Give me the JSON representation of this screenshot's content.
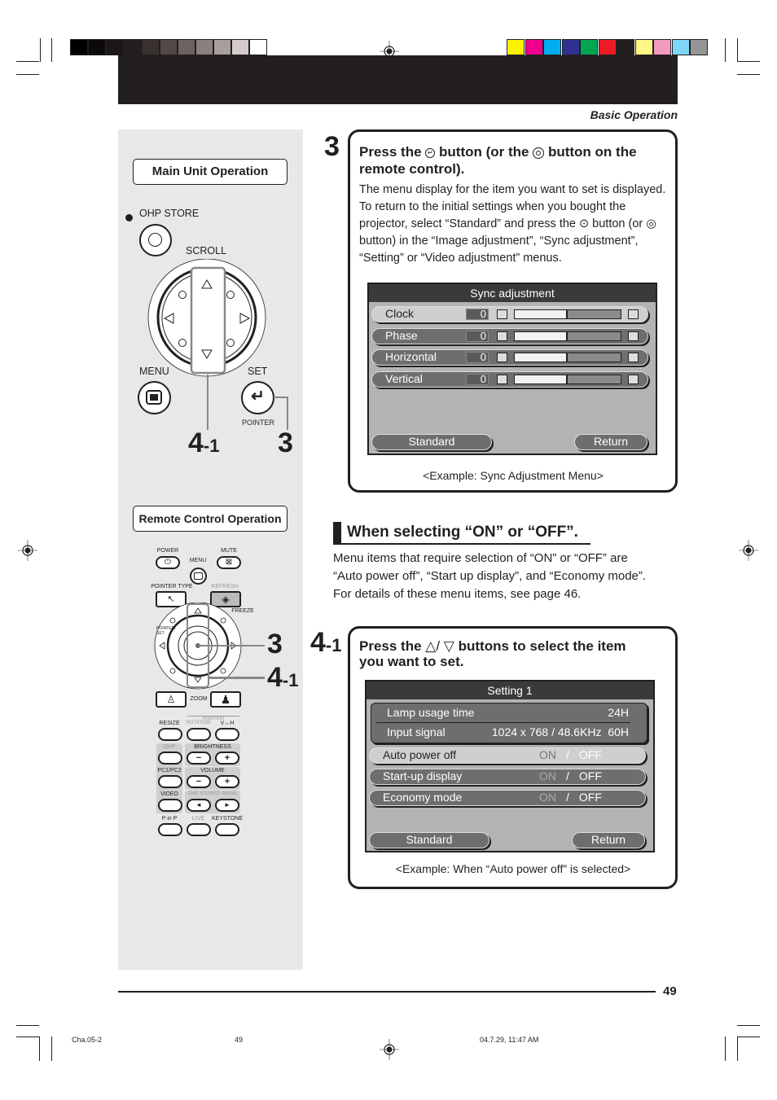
{
  "print_marks": {
    "gray_swatches": [
      "#000000",
      "#0d0b0a",
      "#1b1716",
      "#231f20",
      "#3a3230",
      "#524846",
      "#6c625f",
      "#8a807d",
      "#a69f9d",
      "#d3cbc9",
      "#ffffff"
    ],
    "color_swatches": [
      "#fff200",
      "#ec008c",
      "#00aeef",
      "#2e3192",
      "#00a651",
      "#ed1c24",
      "#231f20",
      "#fff685",
      "#f49ac1",
      "#7dd6f7",
      "#959595"
    ]
  },
  "header": {
    "section": "Basic Operation"
  },
  "left_panel": {
    "main_unit_label": "Main Unit Operation",
    "ohp_store": "OHP STORE",
    "scroll": "SCROLL",
    "menu": "MENU",
    "set": "SET",
    "pointer": "POINTER",
    "callout_4_main": "4",
    "callout_4_sub": "-1",
    "callout_3": "3",
    "remote_label": "Remote Control Operation",
    "remote": {
      "power": "POWER",
      "mute": "MUTE",
      "menu": "MENU",
      "pointer_type": "POINTER TYPE",
      "refresh": "REFRESH",
      "freeze": "FREEZE",
      "pointer_set": "POINTER/ SET",
      "zoom": "ZOOM",
      "position": "POSITION",
      "resize": "RESIZE",
      "rotation": "ROTATION",
      "vh": "V↔H",
      "ohp": "OHP",
      "brightness": "BRIGHTNESS",
      "pc1pc2": "PC1/PC2",
      "volume": "VOLUME",
      "video": "VIDEO",
      "ohp_stored_image": "OHP STORED IMAGE",
      "pinp": "P in P",
      "live": "LIVE",
      "keystone": "KEYSTONE",
      "minus": "−",
      "plus": "+",
      "prev": "◄",
      "next": "►"
    }
  },
  "step3": {
    "number": "3",
    "title_a": "Press the",
    "title_b": "button (or the",
    "title_c": "button on the remote control).",
    "body": [
      "The menu display for the item you want to set is displayed.",
      "To return to the initial settings when you bought the",
      "projector, select “Standard” and press the ⊙ button (or ◎",
      "button) in the “Image adjustment”, “Sync adjustment”,",
      "“Setting” or “Video adjustment” menus."
    ],
    "menu": {
      "title": "Sync adjustment",
      "rows": [
        {
          "label": "Clock",
          "value": "0",
          "level": 0.5
        },
        {
          "label": "Phase",
          "value": "0",
          "level": 0.5
        },
        {
          "label": "Horizontal",
          "value": "0",
          "level": 0.5
        },
        {
          "label": "Vertical",
          "value": "0",
          "level": 0.5
        }
      ],
      "standard": "Standard",
      "return": "Return"
    },
    "caption": "<Example: Sync Adjustment Menu>"
  },
  "onoff": {
    "heading": "When selecting “ON” or “OFF”.",
    "body": [
      "Menu items that require selection of “ON” or “OFF” are",
      "“Auto power off”, “Start up display”, and “Economy mode”.",
      "For details of these menu items, see page 46."
    ]
  },
  "step41": {
    "number": "4",
    "sub": "-1",
    "title_a": "Press the",
    "title_b": "△/ ▽",
    "title_c": "buttons to select the item",
    "title_d": "you want to set.",
    "menu": {
      "title": "Setting 1",
      "info": [
        {
          "label": "Lamp usage time",
          "value": "24H"
        },
        {
          "label": "Input signal",
          "value": "1024 x 768 / 48.6KHz  60H"
        }
      ],
      "rows": [
        {
          "label": "Auto power off",
          "on": "ON",
          "sep": "/",
          "off": "OFF",
          "selected": true
        },
        {
          "label": "Start-up display",
          "on": "ON",
          "sep": "/",
          "off": "OFF",
          "selected": false
        },
        {
          "label": "Economy mode",
          "on": "ON",
          "sep": "/",
          "off": "OFF",
          "selected": false
        }
      ],
      "standard": "Standard",
      "return": "Return"
    },
    "caption": "<Example: When “Auto power off” is selected>"
  },
  "footer": {
    "page_number": "49",
    "slug_file": "Cha.05-2",
    "slug_page": "49",
    "slug_date": "04.7.29, 11:47 AM"
  }
}
